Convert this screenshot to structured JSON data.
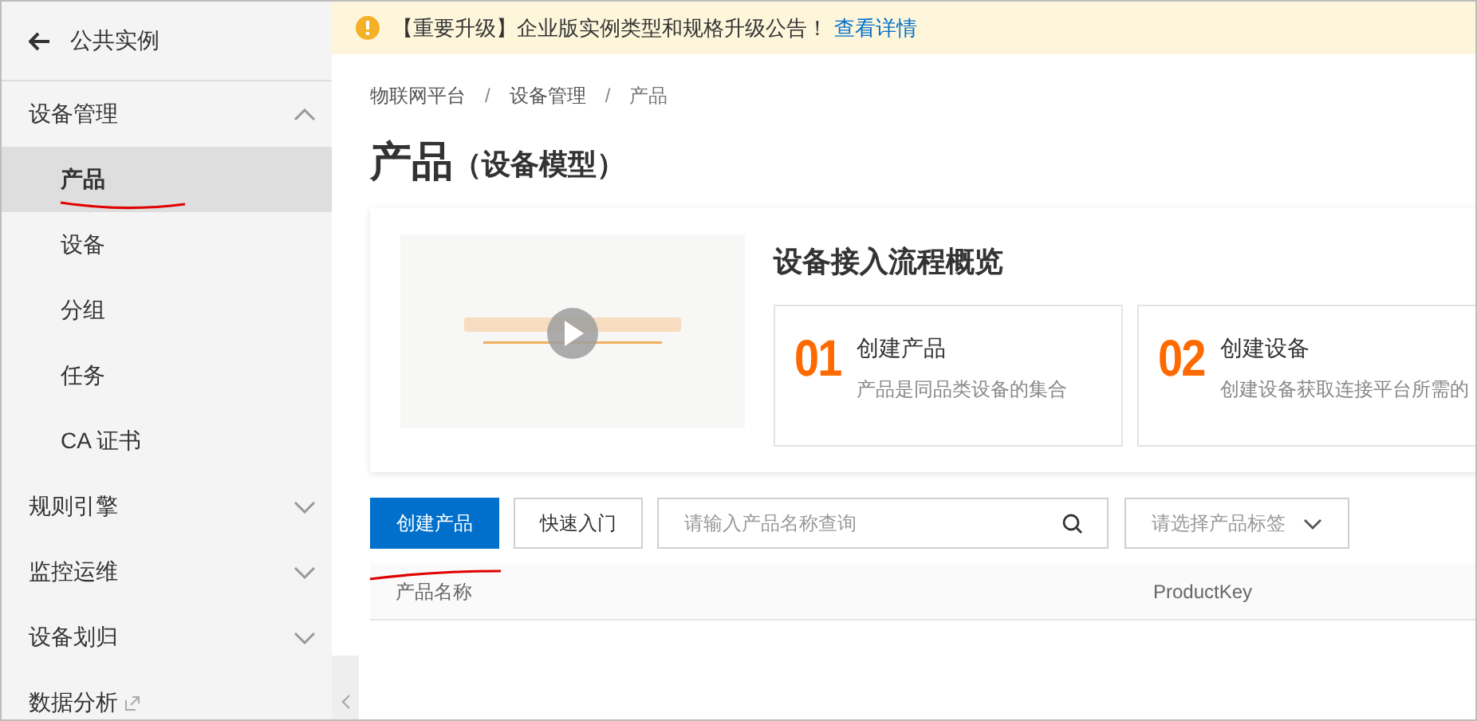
{
  "sidebar": {
    "back_label": "公共实例",
    "groups": [
      {
        "label": "设备管理",
        "kind": "group",
        "expanded": true,
        "children": [
          {
            "label": "产品",
            "selected": true
          },
          {
            "label": "设备",
            "selected": false
          },
          {
            "label": "分组",
            "selected": false
          },
          {
            "label": "任务",
            "selected": false
          },
          {
            "label": "CA 证书",
            "selected": false
          }
        ]
      },
      {
        "label": "规则引擎",
        "kind": "group",
        "expanded": false
      },
      {
        "label": "监控运维",
        "kind": "group",
        "expanded": false
      },
      {
        "label": "设备划归",
        "kind": "group",
        "expanded": false
      },
      {
        "label": "数据分析",
        "kind": "external"
      }
    ]
  },
  "banner": {
    "text": "【重要升级】企业版实例类型和规格升级公告！",
    "link": "查看详情"
  },
  "breadcrumb": {
    "separator": "/",
    "items": [
      "物联网平台",
      "设备管理",
      "产品"
    ]
  },
  "title": "产品",
  "subtitle": "（设备模型）",
  "overview": {
    "heading": "设备接入流程概览",
    "steps": [
      {
        "number": "01",
        "title": "创建产品",
        "description": "产品是同品类设备的集合"
      },
      {
        "number": "02",
        "title": "创建设备",
        "description": "创建设备获取连接平台所需的"
      }
    ]
  },
  "toolbar": {
    "create_button": "创建产品",
    "quick_start_button": "快速入门",
    "search": {
      "placeholder": "请输入产品名称查询"
    },
    "tag_select": {
      "placeholder": "请选择产品标签"
    }
  },
  "table": {
    "columns": [
      "产品名称",
      "ProductKey"
    ]
  }
}
